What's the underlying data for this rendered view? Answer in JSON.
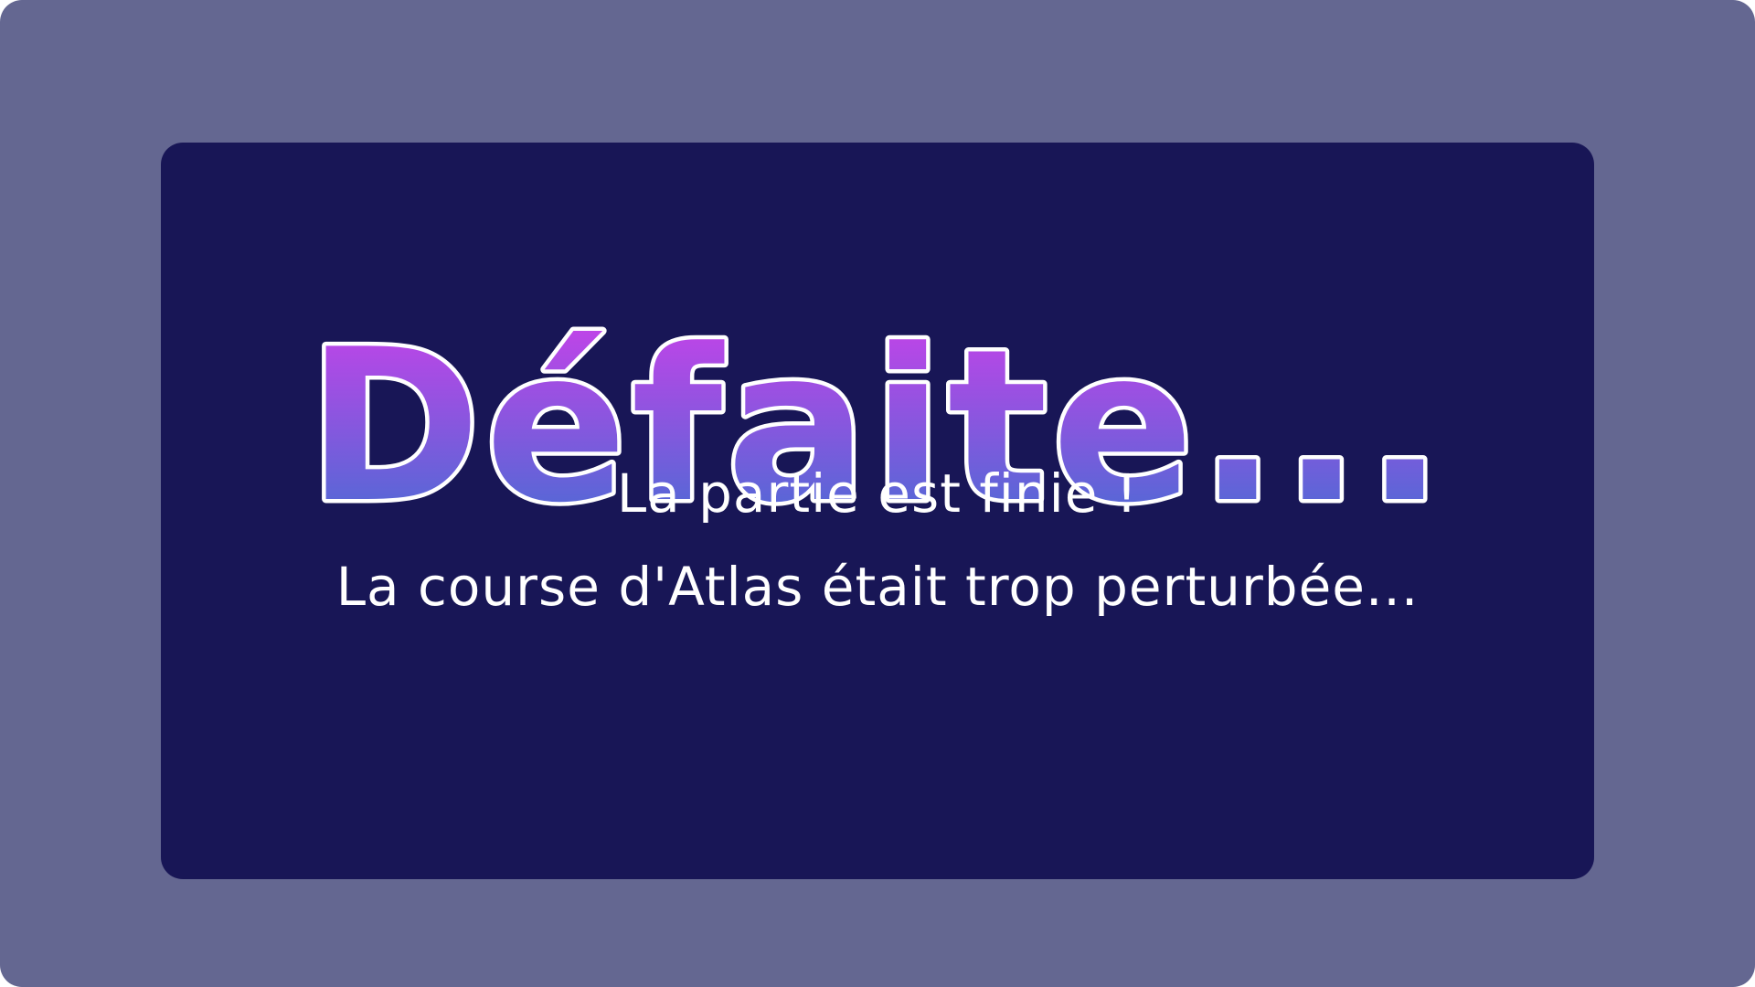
{
  "screen": {
    "title": "Défaite...",
    "lines": [
      "La partie est finie !",
      "La course d'Atlas était trop perturbée..."
    ]
  },
  "colors": {
    "frame": "#646791",
    "panel": "#181656",
    "title_gradient_top": "#cc40ea",
    "title_gradient_bottom": "#3f6fd2",
    "title_outline": "#ffffff",
    "text": "#ffffff"
  }
}
